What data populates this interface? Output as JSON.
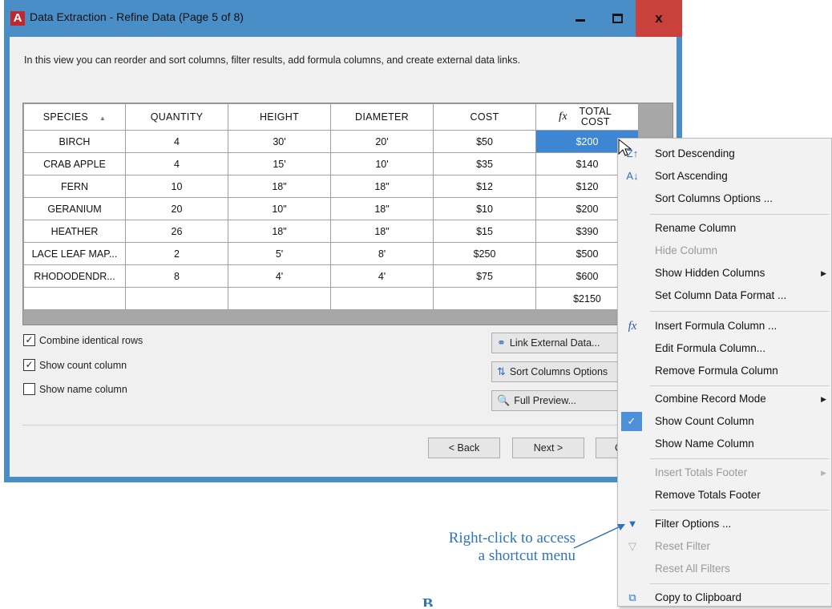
{
  "window": {
    "title": "Data Extraction - Refine Data (Page 5 of 8)",
    "app_icon_letter": "A",
    "close_glyph": "x"
  },
  "description": "In this view you can reorder and sort columns, filter results, add formula columns, and create external data links.",
  "grid": {
    "headers": [
      "SPECIES",
      "QUANTITY",
      "HEIGHT",
      "DIAMETER",
      "COST",
      "TOTAL COST"
    ],
    "fx_symbol": "fx",
    "rows": [
      [
        "BIRCH",
        "4",
        "30'",
        "20'",
        "$50",
        "$200"
      ],
      [
        "CRAB APPLE",
        "4",
        "15'",
        "10'",
        "$35",
        "$140"
      ],
      [
        "FERN",
        "10",
        "18\"",
        "18\"",
        "$12",
        "$120"
      ],
      [
        "GERANIUM",
        "20",
        "10\"",
        "18\"",
        "$10",
        "$200"
      ],
      [
        "HEATHER",
        "26",
        "18\"",
        "18\"",
        "$15",
        "$390"
      ],
      [
        "LACE LEAF MAP...",
        "2",
        "5'",
        "8'",
        "$250",
        "$500"
      ],
      [
        "RHODODENDR...",
        "8",
        "4'",
        "4'",
        "$75",
        "$600"
      ]
    ],
    "footer_total": "$2150"
  },
  "options": {
    "combine_identical_rows": {
      "label": "Combine identical rows",
      "checked": true
    },
    "show_count_column": {
      "label": "Show count column",
      "checked": true
    },
    "show_name_column": {
      "label": "Show name column",
      "checked": false
    }
  },
  "side_buttons": {
    "link_external": "Link External Data...",
    "sort_columns": "Sort Columns Options",
    "full_preview": "Full Preview..."
  },
  "nav": {
    "back": "< Back",
    "next": "Next >",
    "cancel": "C"
  },
  "context_menu": {
    "items": [
      {
        "label": "Sort Descending",
        "icon": "sort-descending-icon",
        "enabled": true
      },
      {
        "label": "Sort Ascending",
        "icon": "sort-ascending-icon",
        "enabled": true
      },
      {
        "label": "Sort Columns Options ...",
        "enabled": true
      },
      {
        "label": "Rename Column",
        "enabled": true
      },
      {
        "label": "Hide Column",
        "enabled": false
      },
      {
        "label": "Show Hidden Columns",
        "enabled": true,
        "submenu": true
      },
      {
        "label": "Set Column Data Format ...",
        "enabled": true
      },
      {
        "label": "Insert Formula Column ...",
        "icon": "fx-icon",
        "enabled": true
      },
      {
        "label": "Edit Formula Column...",
        "enabled": true
      },
      {
        "label": "Remove Formula Column",
        "enabled": true
      },
      {
        "label": "Combine Record Mode",
        "enabled": true,
        "submenu": true
      },
      {
        "label": "Show Count Column",
        "enabled": true,
        "checked": true
      },
      {
        "label": "Show Name Column",
        "enabled": true
      },
      {
        "label": "Insert Totals Footer",
        "enabled": false,
        "submenu": true
      },
      {
        "label": "Remove Totals Footer",
        "enabled": true
      },
      {
        "label": "Filter Options ...",
        "icon": "filter-icon",
        "enabled": true
      },
      {
        "label": "Reset Filter",
        "icon": "reset-filter-icon",
        "enabled": false
      },
      {
        "label": "Reset All Filters",
        "enabled": false
      },
      {
        "label": "Copy to Clipboard",
        "icon": "clipboard-icon",
        "enabled": true
      }
    ]
  },
  "annotation": {
    "line1": "Right-click to access",
    "line2": "a shortcut menu"
  },
  "figure_letter": "B",
  "colors": {
    "window_frame": "#4a8ec7",
    "close_button": "#c9413a",
    "selection": "#3c86d3",
    "annotation": "#2f74b8"
  }
}
